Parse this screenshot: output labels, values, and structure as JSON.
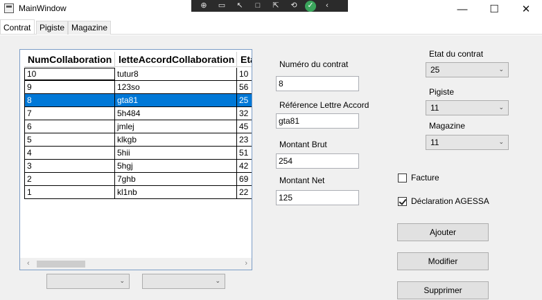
{
  "window": {
    "title": "MainWindow",
    "minimize_glyph": "—",
    "maximize_glyph": "☐",
    "close_glyph": "✕"
  },
  "debug_toolbar": {
    "icons": [
      "select-element-icon",
      "video-icon",
      "cursor-icon",
      "frame-icon",
      "touch-icon",
      "hot-reload-icon",
      "ok-icon",
      "collapse-icon"
    ],
    "glyphs": [
      "⊕",
      "▭",
      "↖",
      "□",
      "⇱",
      "⟲",
      "✓",
      "‹"
    ]
  },
  "tabs": [
    {
      "label": "Contrat",
      "active": true
    },
    {
      "label": "Pigiste",
      "active": false
    },
    {
      "label": "Magazine",
      "active": false
    }
  ],
  "grid": {
    "columns": [
      "NumCollaboration",
      "letteAccordCollaboration",
      "Eta"
    ],
    "rows": [
      {
        "num": "10",
        "lettre": "tutur8",
        "etat": "10"
      },
      {
        "num": "9",
        "lettre": "123so",
        "etat": "56"
      },
      {
        "num": "8",
        "lettre": "gta81",
        "etat": "25"
      },
      {
        "num": "7",
        "lettre": "5h484",
        "etat": "32"
      },
      {
        "num": "6",
        "lettre": "jmlej",
        "etat": "45"
      },
      {
        "num": "5",
        "lettre": "klkgb",
        "etat": "23"
      },
      {
        "num": "4",
        "lettre": "5hii",
        "etat": "51"
      },
      {
        "num": "3",
        "lettre": "5hgj",
        "etat": "42"
      },
      {
        "num": "2",
        "lettre": "7ghb",
        "etat": "69"
      },
      {
        "num": "1",
        "lettre": "kl1nb",
        "etat": "22"
      }
    ],
    "selected_index": 2,
    "scroll_left": "‹",
    "scroll_right": "›"
  },
  "bottom_combos": [
    {
      "value": "",
      "chevron": "⌄"
    },
    {
      "value": "",
      "chevron": "⌄"
    }
  ],
  "form": {
    "numero_label": "Numéro du contrat",
    "numero_value": "8",
    "reference_label": "Référence Lettre Accord",
    "reference_value": "gta81",
    "brut_label": "Montant Brut",
    "brut_value": "254",
    "net_label": "Montant Net",
    "net_value": "125"
  },
  "right_panel": {
    "etat_label": "Etat du contrat",
    "etat_value": "25",
    "pigiste_label": "Pigiste",
    "pigiste_value": "11",
    "magazine_label": "Magazine",
    "magazine_value": "11",
    "chevron": "⌄",
    "facture_label": "Facture",
    "facture_checked": false,
    "agessa_label": "Déclaration AGESSA",
    "agessa_checked": true
  },
  "buttons": {
    "add": "Ajouter",
    "edit": "Modifier",
    "delete": "Supprimer"
  }
}
